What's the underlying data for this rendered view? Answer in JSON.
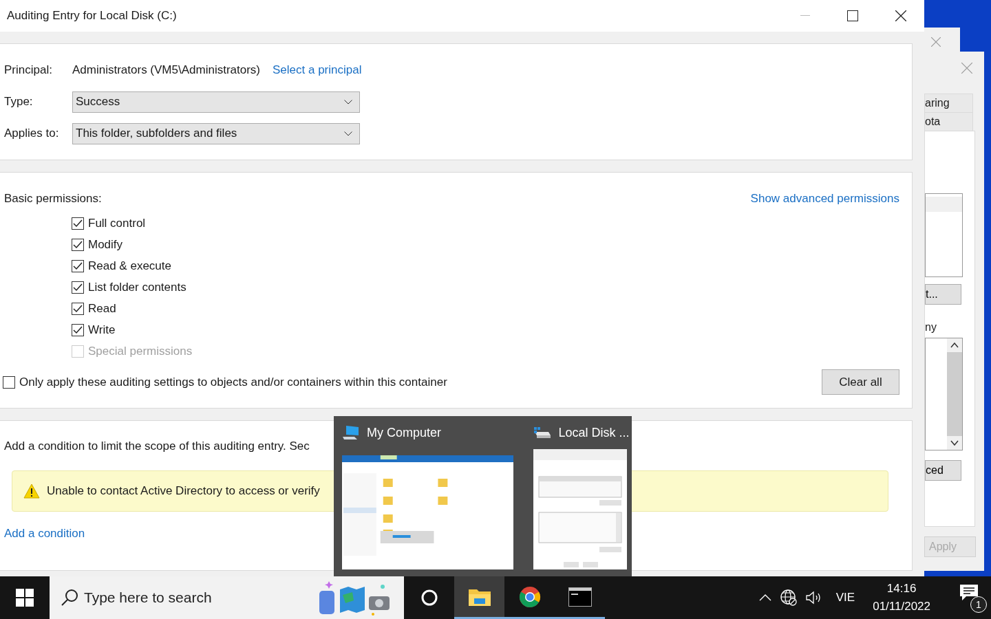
{
  "window": {
    "title": "Auditing Entry for Local Disk (C:)"
  },
  "principal": {
    "label": "Principal:",
    "value": "Administrators (VM5\\Administrators)",
    "link": "Select a principal"
  },
  "type": {
    "label": "Type:",
    "value": "Success"
  },
  "applies_to": {
    "label": "Applies to:",
    "value": "This folder, subfolders and files"
  },
  "permissions": {
    "heading": "Basic permissions:",
    "advanced_link": "Show advanced permissions",
    "items": [
      {
        "label": "Full control",
        "checked": true,
        "disabled": false
      },
      {
        "label": "Modify",
        "checked": true,
        "disabled": false
      },
      {
        "label": "Read & execute",
        "checked": true,
        "disabled": false
      },
      {
        "label": "List folder contents",
        "checked": true,
        "disabled": false
      },
      {
        "label": "Read",
        "checked": true,
        "disabled": false
      },
      {
        "label": "Write",
        "checked": true,
        "disabled": false
      },
      {
        "label": "Special permissions",
        "checked": false,
        "disabled": true
      }
    ]
  },
  "only_apply": {
    "label": "Only apply these auditing settings to objects and/or containers within this container",
    "checked": false
  },
  "clear_all": "Clear all",
  "condition": {
    "text": "Add a condition to limit the scope of this auditing entry. Sec",
    "warning": "Unable to contact Active Directory to access or verify",
    "add_link": "Add a condition"
  },
  "taskbar_preview": {
    "items": [
      {
        "title": "My Computer",
        "kind": "computer"
      },
      {
        "title": "Local Disk ...",
        "kind": "disk"
      }
    ]
  },
  "background_window": {
    "tabs": [
      {
        "label": "aring"
      },
      {
        "label": "ota"
      }
    ],
    "edit_button": "t...",
    "list_label": "ny",
    "advanced_button": "ced",
    "apply_button": {
      "label": "Apply",
      "disabled": true
    }
  },
  "taskbar": {
    "search": {
      "placeholder": "Type here to search"
    },
    "apps": [
      {
        "kind": "cortana",
        "selected": false,
        "running": false
      },
      {
        "kind": "explorer",
        "selected": true,
        "running": true
      },
      {
        "kind": "chrome",
        "selected": false,
        "running": true
      },
      {
        "kind": "terminal",
        "selected": false,
        "running": true
      }
    ],
    "language": "VIE",
    "time": "14:16",
    "date": "01/11/2022",
    "notifications": "1"
  }
}
